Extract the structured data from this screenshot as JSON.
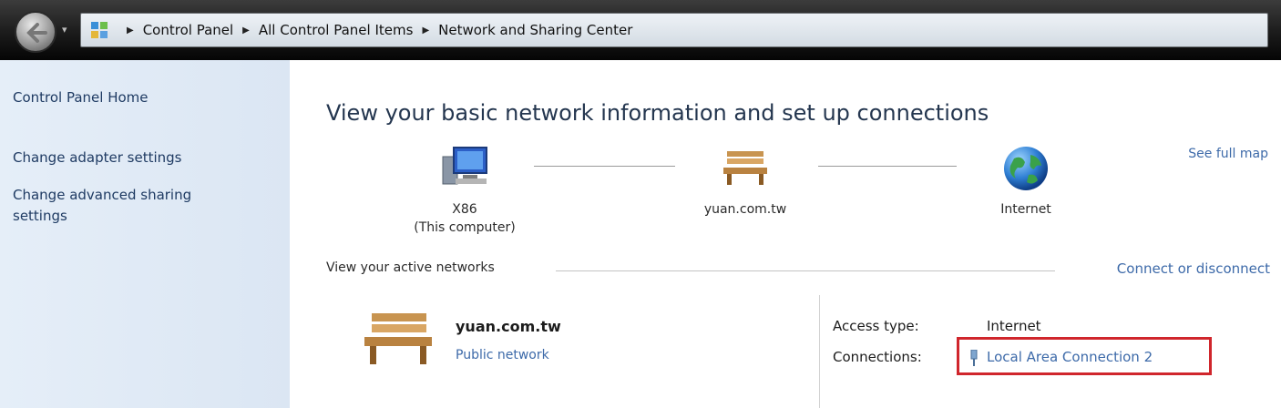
{
  "address_bar": {
    "dropdown_glyph": "▾",
    "separator": "▶",
    "breadcrumbs": [
      "Control Panel",
      "All Control Panel Items",
      "Network and Sharing Center"
    ]
  },
  "sidebar": {
    "links": [
      "Control Panel Home",
      "Change adapter settings",
      "Change advanced sharing settings"
    ]
  },
  "main": {
    "heading": "View your basic network information and set up connections",
    "see_full_map": "See full map",
    "map": {
      "computer": {
        "name": "X86",
        "sub": "(This computer)",
        "icon": "computer-icon"
      },
      "network": {
        "name": "yuan.com.tw",
        "icon": "bench-icon"
      },
      "internet": {
        "name": "Internet",
        "icon": "globe-icon"
      }
    },
    "active_networks_label": "View your active networks",
    "connect_or_disconnect": "Connect or disconnect",
    "active_network": {
      "name": "yuan.com.tw",
      "category": "Public network",
      "access_type_label": "Access type:",
      "access_type_value": "Internet",
      "connections_label": "Connections:",
      "connections_value": "Local Area Connection 2"
    }
  },
  "colors": {
    "link": "#3d6aa9",
    "highlight_box": "#d0262c",
    "sidebar_bg": "#e5eef8"
  }
}
